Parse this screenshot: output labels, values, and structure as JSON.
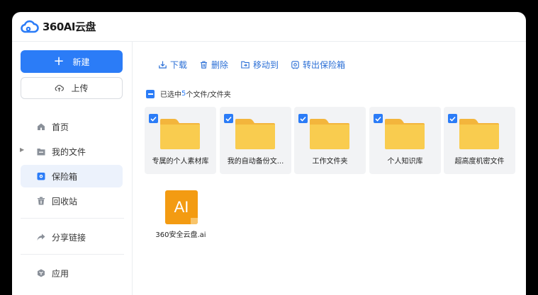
{
  "app": {
    "title": "360AI云盘",
    "accent": "#2b7cf7",
    "folder_color": "#f9cc4f"
  },
  "sidebar": {
    "new_label": "新建",
    "upload_label": "上传",
    "items": [
      {
        "label": "首页",
        "icon": "home-icon"
      },
      {
        "label": "我的文件",
        "icon": "folder-icon"
      },
      {
        "label": "保险箱",
        "icon": "safe-icon"
      },
      {
        "label": "回收站",
        "icon": "trash-icon"
      },
      {
        "label": "分享链接",
        "icon": "share-icon"
      },
      {
        "label": "应用",
        "icon": "apps-icon"
      }
    ]
  },
  "toolbar": {
    "download": "下载",
    "delete": "删除",
    "move": "移动到",
    "move_out": "转出保险箱"
  },
  "selection": {
    "prefix": "已选中",
    "count": "5",
    "suffix": "个文件/文件夹"
  },
  "folders": [
    {
      "name": "专属的个人素材库"
    },
    {
      "name": "我的自动备份文..."
    },
    {
      "name": "工作文件夹"
    },
    {
      "name": "个人知识库"
    },
    {
      "name": "超高度机密文件"
    }
  ],
  "file": {
    "name": "360安全云盘.ai",
    "badge": "AI"
  }
}
